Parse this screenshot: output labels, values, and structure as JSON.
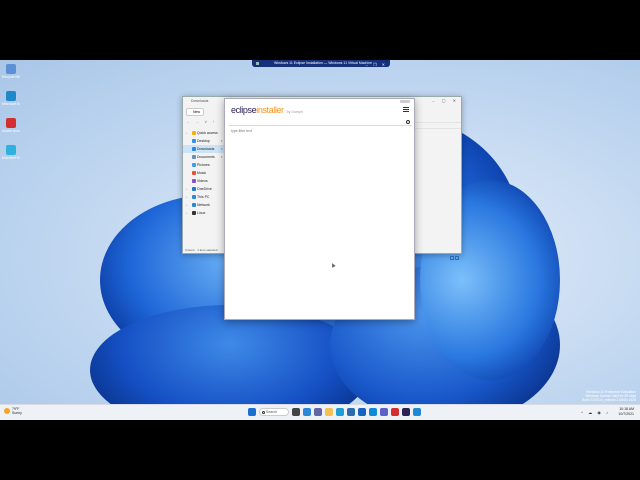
{
  "remote_bar": {
    "title": "Windows 11 Eclipse Installation — Windows 11 Virtual Machine"
  },
  "desktop": {
    "icons": [
      {
        "label": "Recycle Bin",
        "color": "#5c8fd6"
      },
      {
        "label": "Microsoft Edge",
        "color": "#1e88c9"
      },
      {
        "label": "Adobe Acrobat",
        "color": "#d32f2f"
      },
      {
        "label": "Microsoft Edge",
        "color": "#2fb1e0"
      }
    ],
    "watermark": {
      "line1": "Windows 11 Enterprise Evaluation",
      "line2": "Windows License valid for 89 days",
      "line3": "Build 22000.ni_release.210604-1628"
    }
  },
  "explorer": {
    "title": "Downloads",
    "new_button": "New",
    "nav_items": [
      {
        "label": "Quick access",
        "icon": "star-icon",
        "color": "#f4b400"
      },
      {
        "label": "Desktop",
        "icon": "desktop-icon",
        "color": "#3a8ee6"
      },
      {
        "label": "Downloads",
        "icon": "download-icon",
        "color": "#2b88d8",
        "selected": true
      },
      {
        "label": "Documents",
        "icon": "documents-icon",
        "color": "#6b8fb3"
      },
      {
        "label": "Pictures",
        "icon": "pictures-icon",
        "color": "#3aa0e8"
      },
      {
        "label": "Music",
        "icon": "music-icon",
        "color": "#e2543b"
      },
      {
        "label": "Videos",
        "icon": "videos-icon",
        "color": "#8a4fd0"
      },
      {
        "label": "OneDrive",
        "icon": "cloud-icon",
        "color": "#1f78d1"
      },
      {
        "label": "This PC",
        "icon": "pc-icon",
        "color": "#2b88d8"
      },
      {
        "label": "Network",
        "icon": "network-icon",
        "color": "#2b88d8"
      },
      {
        "label": "Linux",
        "icon": "linux-icon",
        "color": "#333333"
      }
    ],
    "status_items": "3 items",
    "status_selected": "1 item selected"
  },
  "installer": {
    "logo_part1": "eclipse",
    "logo_part2": "installer",
    "logo_by": "by Oomph",
    "filter_placeholder": "type filter text"
  },
  "taskbar": {
    "weather_temp": "79°F",
    "weather_desc": "Sunny",
    "search_label": "Search",
    "apps": [
      {
        "name": "windows-start-icon",
        "color": "#1b6fd1"
      },
      {
        "name": "task-view-icon",
        "color": "#444444"
      },
      {
        "name": "widgets-icon",
        "color": "#2b88d8"
      },
      {
        "name": "chat-icon",
        "color": "#6264a7"
      },
      {
        "name": "file-explorer-icon",
        "color": "#f2c14e"
      },
      {
        "name": "edge-icon",
        "color": "#1e9ed6"
      },
      {
        "name": "store-icon",
        "color": "#2b6cb0"
      },
      {
        "name": "mail-icon",
        "color": "#1565c0"
      },
      {
        "name": "photos-icon",
        "color": "#0f8bd6"
      },
      {
        "name": "teams-icon",
        "color": "#5b5fc7"
      },
      {
        "name": "acrobat-icon",
        "color": "#d32f2f"
      },
      {
        "name": "eclipse-icon",
        "color": "#2c2255"
      },
      {
        "name": "vscode-icon",
        "color": "#1f8ad2"
      }
    ],
    "time": "10:18 AM",
    "date": "10/7/2021"
  }
}
